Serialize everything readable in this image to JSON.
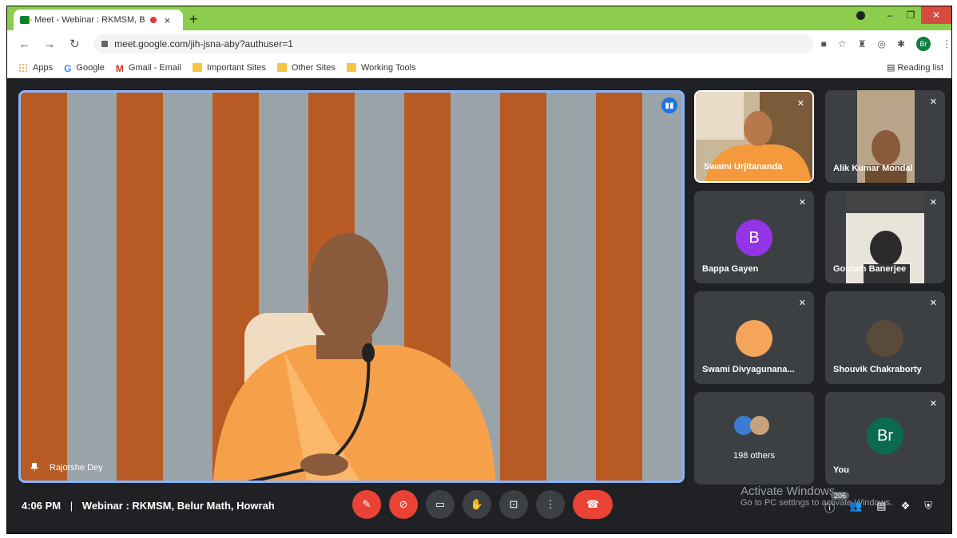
{
  "browser": {
    "tab_title": "Meet - Webinar : RKMSM, B",
    "new_tab": "+",
    "tab_close": "×",
    "address": "meet.google.com/jih-jsna-aby?authuser=1",
    "profile_initials": "Br",
    "window_controls": {
      "minimize": "–",
      "restore": "❐",
      "close": "✕"
    }
  },
  "bookmarks": {
    "items": [
      "Apps",
      "Google",
      "Gmail - Email",
      "Important Sites",
      "Other Sites",
      "Working Tools"
    ],
    "reading_list": "Reading list"
  },
  "meet": {
    "main_speaker": "Rajorshe Dey",
    "participants": [
      {
        "name": "Swami Urjitananda"
      },
      {
        "name": "Alik Kumar Mondal"
      },
      {
        "name": "Bappa Gayen",
        "initial": "B",
        "avatar_color": "#9334e6"
      },
      {
        "name": "Goutam Banerjee"
      },
      {
        "name": "Swami Divyagunana..."
      },
      {
        "name": "Shouvik Chakraborty"
      },
      {
        "name": "198 others"
      },
      {
        "name": "You",
        "initial": "Br",
        "avatar_color": "#0b6b4f"
      }
    ],
    "time": "4:06 PM",
    "separator": "|",
    "meeting_title": "Webinar : RKMSM, Belur Math, Howrah",
    "participant_count": "206",
    "colors": {
      "accent": "#8ab4f8",
      "end_call": "#ea4335"
    }
  },
  "watermark": {
    "line1": "Activate Windows",
    "line2": "Go to PC settings to activate Windows."
  }
}
